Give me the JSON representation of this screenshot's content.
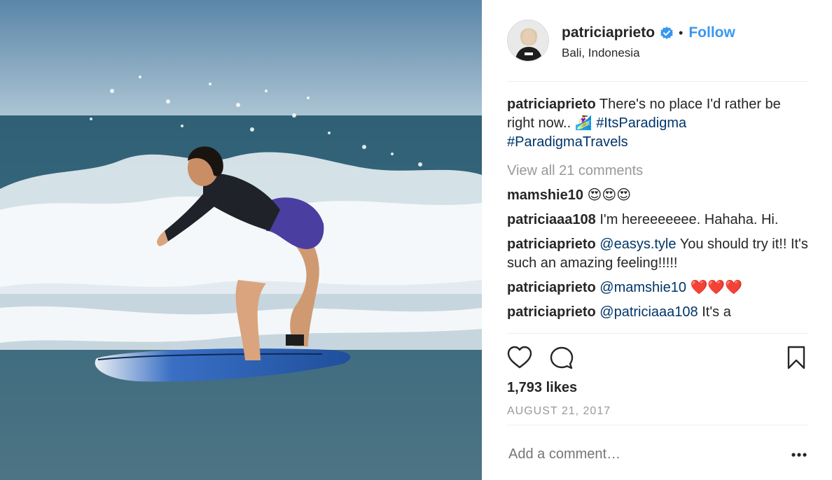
{
  "post": {
    "username": "patriciaprieto",
    "follow_label": "Follow",
    "separator": "•",
    "location": "Bali, Indonesia",
    "caption": {
      "user": "patriciaprieto",
      "text": " There's no place I'd rather be right now.. 🏄‍♀️ ",
      "tag1": "#ItsParadigma",
      "tag2": "#ParadigmaTravels"
    },
    "view_all": "View all 21 comments",
    "comments": [
      {
        "user": "mamshie10",
        "text": " 😍😍😍"
      },
      {
        "user": "patriciaaa108",
        "text": " I'm hereeeeeee. Hahaha. Hi."
      },
      {
        "user": "patriciaprieto",
        "mention": "@easys.tyle",
        "text": " You should try it!! It's such an amazing feeling!!!!!"
      },
      {
        "user": "patriciaprieto",
        "mention": "@mamshie10",
        "text": " ❤️❤️❤️"
      },
      {
        "user": "patriciaprieto",
        "mention": "@patriciaaa108",
        "text": " It's a"
      }
    ],
    "likes": "1,793 likes",
    "date": "AUGUST 21, 2017",
    "add_comment_placeholder": "Add a comment…"
  },
  "icons": {
    "like": "heart-icon",
    "comment": "comment-bubble-icon",
    "save": "bookmark-icon",
    "more": "more-options-icon",
    "verified": "verified-badge-icon"
  },
  "colors": {
    "link_blue": "#3897f0",
    "hashtag": "#003569",
    "muted": "#999999",
    "text": "#262626"
  }
}
